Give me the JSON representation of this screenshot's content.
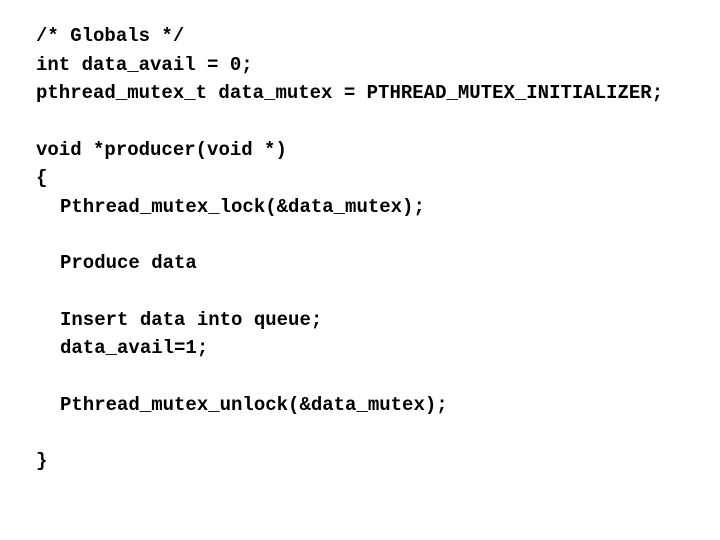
{
  "code": {
    "l1": "/* Globals */",
    "l2": "int data_avail = 0;",
    "l3": "pthread_mutex_t data_mutex = PTHREAD_MUTEX_INITIALIZER;",
    "l4_a": "void *",
    "l4_b": "producer",
    "l4_c": "(void *)",
    "l5": "{",
    "l6": "Pthread_mutex_lock(&data_mutex);",
    "l7": "Produce data",
    "l8": "Insert data into queue;",
    "l9": "data_avail=1;",
    "l10": "Pthread_mutex_unlock(&data_mutex);",
    "l11": "}"
  }
}
